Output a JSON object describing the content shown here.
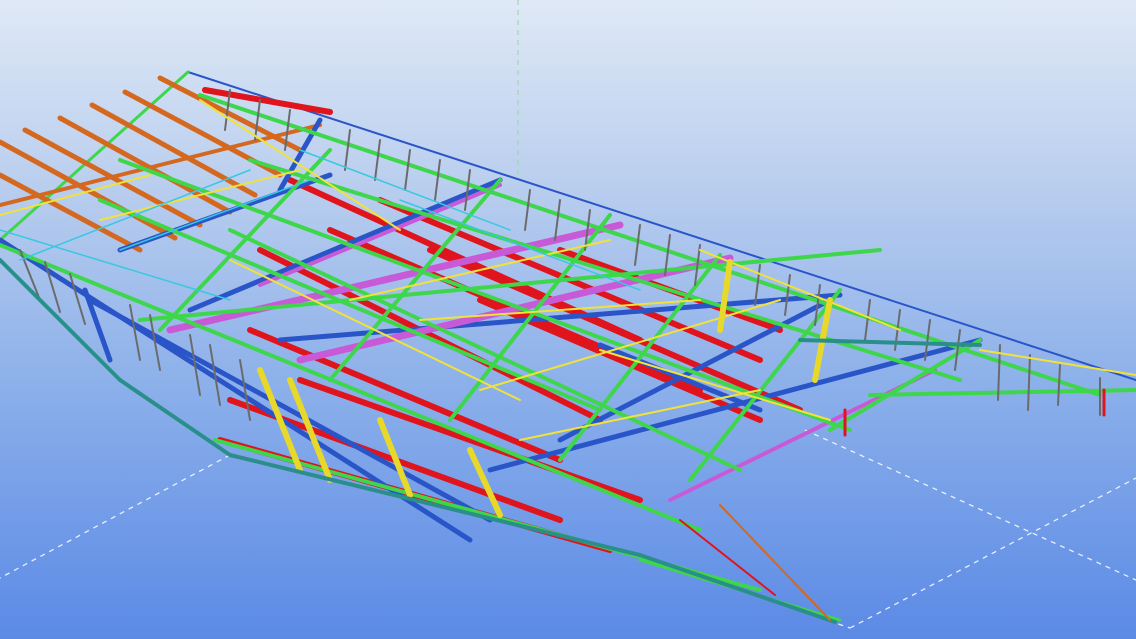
{
  "viewport": {
    "background_top": "#dfe9f6",
    "background_bottom": "#5b8ae6"
  },
  "palette": {
    "beam_red": "#e0141c",
    "beam_green": "#3ed64a",
    "beam_blue": "#2a55c8",
    "beam_orange": "#d4681e",
    "beam_magenta": "#c85ad8",
    "beam_yellow": "#f0e23a",
    "beam_cyan": "#38c8e0",
    "beam_teal": "#2a8f8a",
    "beam_gray": "#6b6b6b",
    "grid_line": "#ffffff"
  },
  "model": {
    "type": "3d-steel-truss-structure",
    "icons": [
      "grid-lines",
      "structural-model"
    ]
  }
}
